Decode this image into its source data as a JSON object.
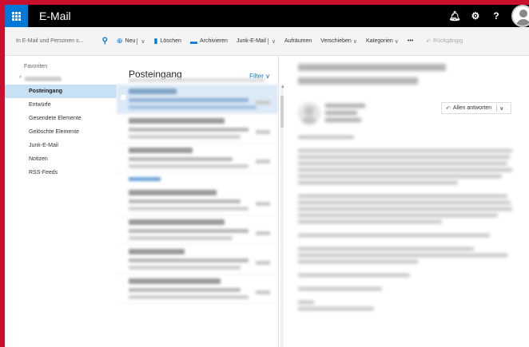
{
  "app": {
    "title": "E-Mail",
    "accent": "#0078d7",
    "frame_color": "#c8102e"
  },
  "topbar": {
    "bell_icon": "bell-icon",
    "settings_icon": "gear-icon",
    "help_label": "?"
  },
  "commands": {
    "search_placeholder": "In E-Mail und Personen s...",
    "new_label": "Neu",
    "delete_label": "Löschen",
    "archive_label": "Archivieren",
    "junk_label": "Junk-E-Mail",
    "sweep_label": "Aufräumen",
    "move_label": "Verschieben",
    "categories_label": "Kategorien",
    "more_label": "•••",
    "undo_label": "Rückgängig"
  },
  "nav": {
    "favorites_label": "Favoriten",
    "items": [
      {
        "label": "Posteingang",
        "active": true
      },
      {
        "label": "Entwürfe"
      },
      {
        "label": "Gesendete Elemente"
      },
      {
        "label": "Gelöschte Elemente"
      },
      {
        "label": "Junk-E-Mail"
      },
      {
        "label": "Notizen"
      },
      {
        "label": "RSS-Feeds"
      }
    ]
  },
  "list": {
    "title": "Posteingang",
    "filter_label": "Filter"
  },
  "reading": {
    "reply_all_label": "Allen antworten"
  }
}
